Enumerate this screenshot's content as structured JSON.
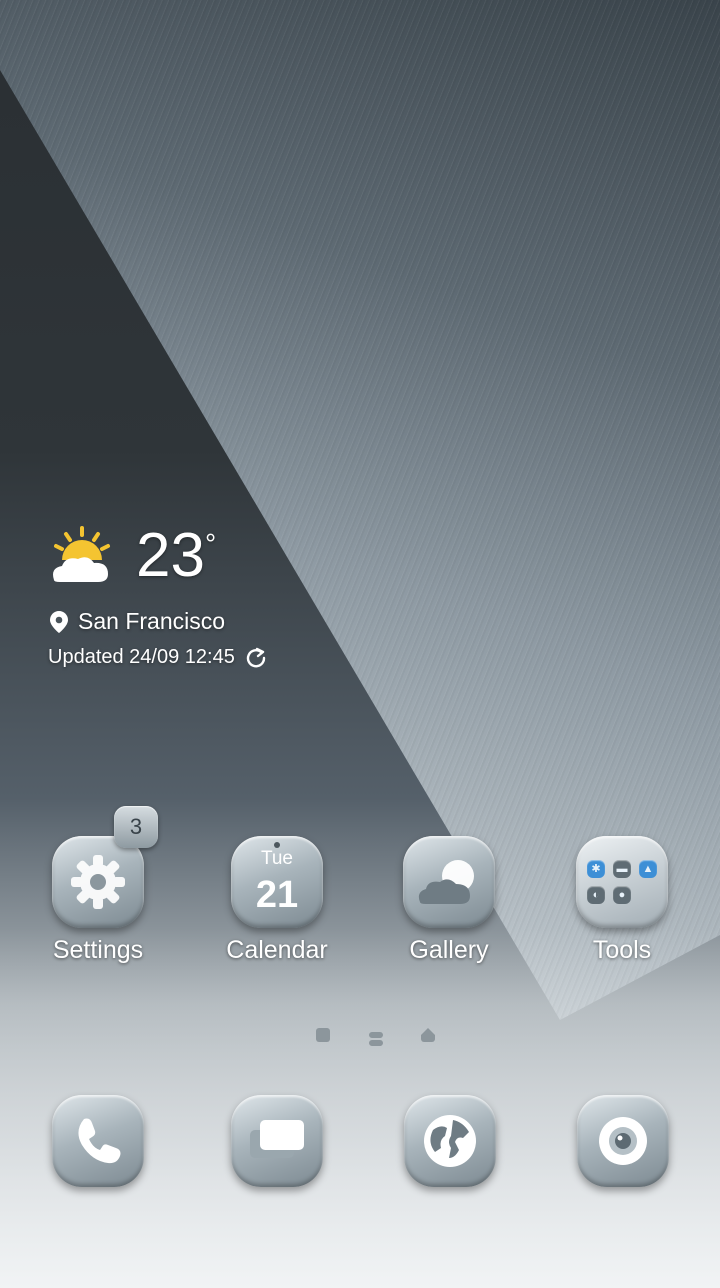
{
  "weather": {
    "temperature": "23",
    "degree_symbol": "°",
    "city": "San Francisco",
    "updated": "Updated 24/09 12:45",
    "icon": "partly-sunny-icon"
  },
  "apps": [
    {
      "label": "Settings",
      "icon": "gear-icon",
      "badge": "3"
    },
    {
      "label": "Calendar",
      "icon": "calendar-icon",
      "day": "Tue",
      "date": "21"
    },
    {
      "label": "Gallery",
      "icon": "gallery-cloud-icon"
    },
    {
      "label": "Tools",
      "icon": "folder-grid-icon"
    }
  ],
  "pager": {
    "pages": 3,
    "current": 1
  },
  "dock": [
    {
      "icon": "phone-icon"
    },
    {
      "icon": "messages-icon"
    },
    {
      "icon": "browser-globe-icon"
    },
    {
      "icon": "camera-icon"
    }
  ],
  "colors": {
    "accent_sun": "#f4c431",
    "tool_blue": "#3d8fd6"
  }
}
